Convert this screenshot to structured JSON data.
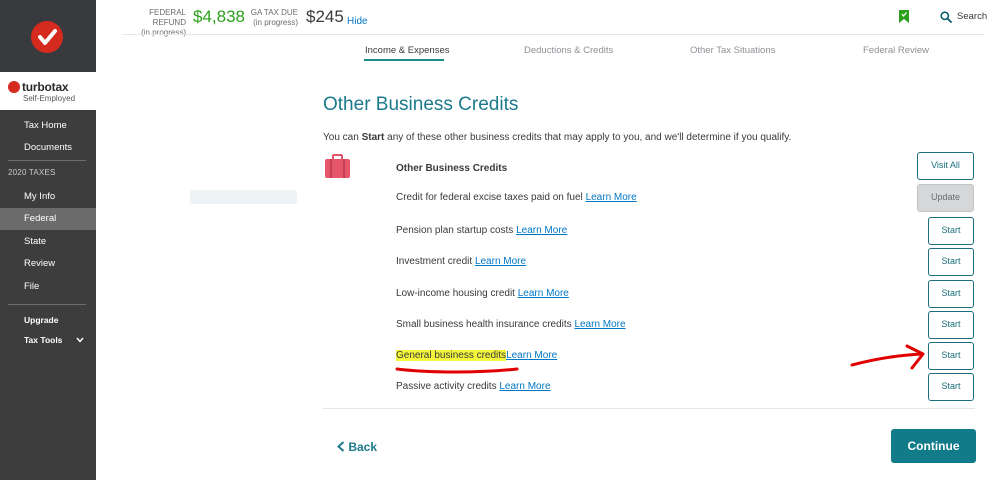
{
  "sidebar": {
    "brand_name": "turbotax",
    "brand_sub": "Self-Employed",
    "items_top": [
      "Tax Home",
      "Documents"
    ],
    "section_label": "2020 TAXES",
    "items_year": [
      "My Info",
      "Federal",
      "State",
      "Review",
      "File"
    ],
    "active_item": "Federal",
    "items_bottom": [
      "Upgrade",
      "Tax Tools"
    ]
  },
  "header": {
    "federal_label_1": "FEDERAL REFUND",
    "federal_label_2": "(in progress)",
    "federal_amount": "$4,838",
    "state_label_1": "GA TAX DUE",
    "state_label_2": "(in progress)",
    "state_amount": "$245",
    "hide_label": "Hide",
    "search_label": "Search"
  },
  "tabs": [
    "Income & Expenses",
    "Deductions & Credits",
    "Other Tax Situations",
    "Federal Review"
  ],
  "active_tab": "Income & Expenses",
  "main": {
    "title": "Other Business Credits",
    "intro_pre": "You can ",
    "intro_bold": "Start",
    "intro_post": " any of these other business credits that may apply to you, and we'll determine if you qualify.",
    "section_heading": "Other Business Credits",
    "visit_all_label": "Visit All",
    "learn_more": "Learn More",
    "rows": [
      {
        "text": "Credit for federal excise taxes paid on fuel",
        "button": "Update"
      },
      {
        "text": "Pension plan startup costs",
        "button": "Start"
      },
      {
        "text": "Investment credit",
        "button": "Start"
      },
      {
        "text": "Low-income housing credit",
        "button": "Start"
      },
      {
        "text": "Small business health insurance credits",
        "button": "Start"
      },
      {
        "text": "General business credits",
        "button": "Start"
      },
      {
        "text": "Passive activity credits",
        "button": "Start"
      }
    ],
    "back_label": "Back",
    "continue_label": "Continue"
  },
  "colors": {
    "sidebar_bg": "#3d3d3d",
    "accent_teal": "#117b8a",
    "link_blue": "#0077c5",
    "refund_green": "#2ca01c",
    "brand_red": "#d52b1e",
    "highlight_yellow": "#f5f53a",
    "annotation_red": "#e00000"
  }
}
